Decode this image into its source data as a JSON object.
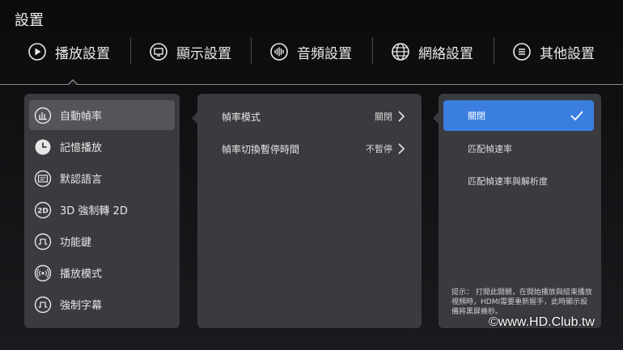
{
  "header": {
    "title": "設置"
  },
  "tabs": [
    {
      "label": "播放設置",
      "icon": "play-icon"
    },
    {
      "label": "顯示設置",
      "icon": "display-icon"
    },
    {
      "label": "音頻設置",
      "icon": "audio-wave-icon"
    },
    {
      "label": "網絡設置",
      "icon": "globe-icon"
    },
    {
      "label": "其他設置",
      "icon": "list-icon"
    }
  ],
  "sidebar": {
    "items": [
      {
        "label": "自動幀率",
        "icon": "bar-chart-icon"
      },
      {
        "label": "記憶播放",
        "icon": "clock-icon"
      },
      {
        "label": "默認語言",
        "icon": "language-icon"
      },
      {
        "label": "3D 強制轉 2D",
        "icon": "2d-icon"
      },
      {
        "label": "功能鍵",
        "icon": "pulse-icon"
      },
      {
        "label": "播放模式",
        "icon": "broadcast-icon"
      },
      {
        "label": "強制字幕",
        "icon": "pulse-icon"
      }
    ]
  },
  "settings": {
    "rows": [
      {
        "label": "幀率模式",
        "value": "關閉"
      },
      {
        "label": "幀率切換暫停時間",
        "value": "不暫停"
      }
    ]
  },
  "options": {
    "items": [
      {
        "label": "關閉"
      },
      {
        "label": "匹配幀速率"
      },
      {
        "label": "匹配幀速率與解析度"
      }
    ],
    "hint": "提示： 打開此開關，在開始播放與結束播放視頻時，HDMI需要重新握手，此時顯示設備將黑屏幾秒。"
  },
  "watermark": "©www.HD.Club.tw",
  "colors": {
    "accent": "#3a7ee0",
    "panel": "#3a3b3f",
    "active_item": "#54555a"
  }
}
